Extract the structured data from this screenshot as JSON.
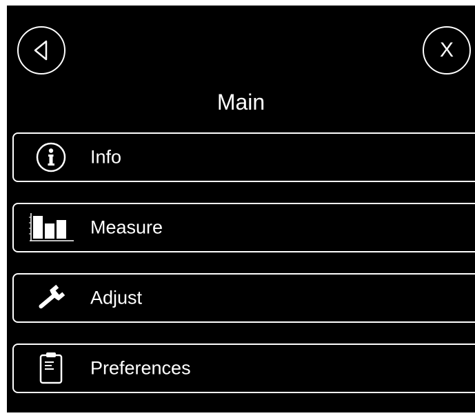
{
  "header": {
    "title": "Main",
    "close_label": "X",
    "back_icon": "back-triangle-icon",
    "close_icon": "close-icon"
  },
  "menu": {
    "items": [
      {
        "label": "Info",
        "icon": "info-icon"
      },
      {
        "label": "Measure",
        "icon": "bar-chart-icon"
      },
      {
        "label": "Adjust",
        "icon": "wrench-icon"
      },
      {
        "label": "Preferences",
        "icon": "clipboard-icon"
      }
    ]
  },
  "colors": {
    "background": "#000000",
    "foreground": "#ffffff"
  }
}
